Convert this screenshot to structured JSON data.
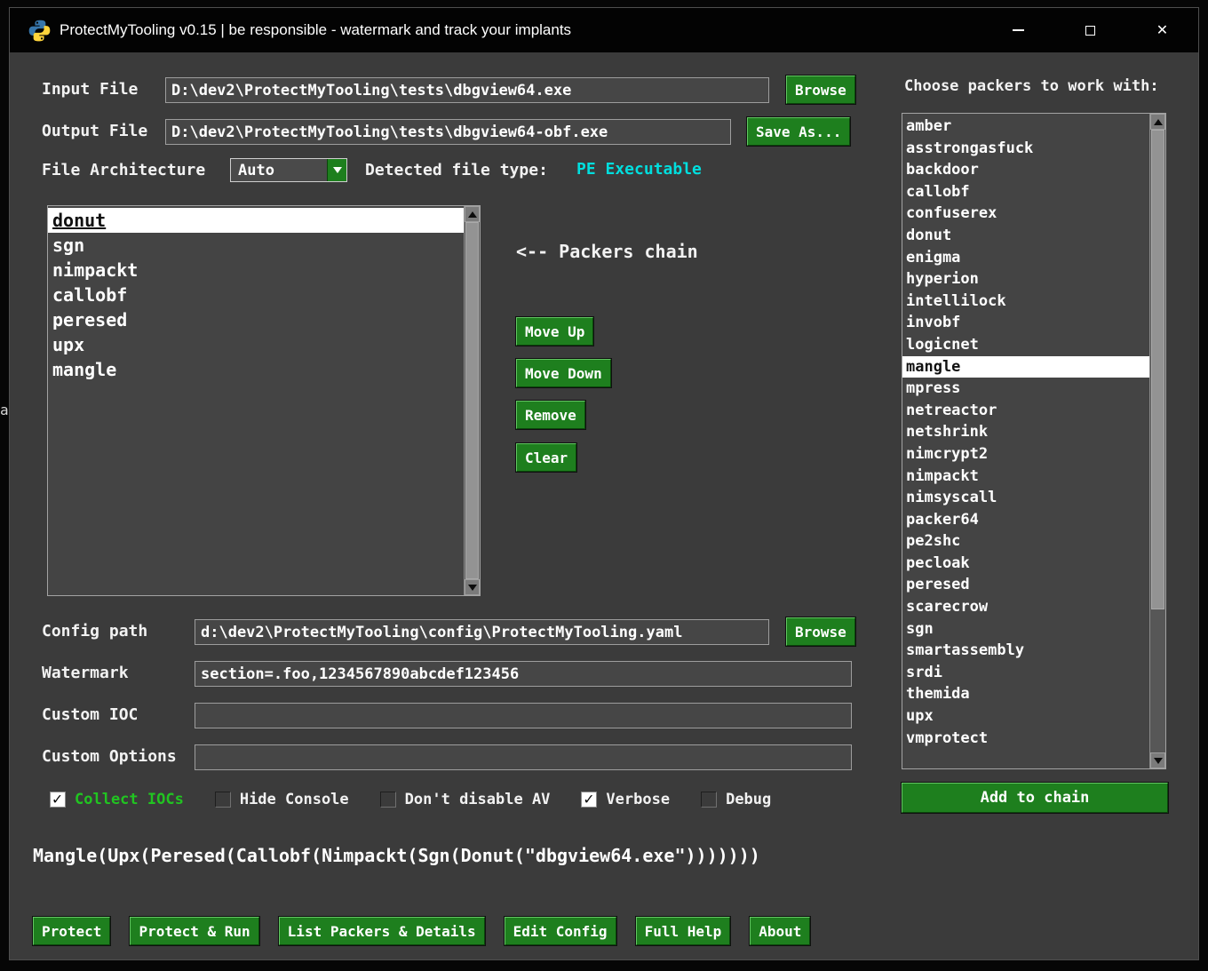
{
  "background": {
    "artifact": "a"
  },
  "window": {
    "title": "ProtectMyTooling v0.15 | be responsible - watermark and track your implants",
    "close_glyph": "✕"
  },
  "form": {
    "input_file_label": "Input File",
    "input_file_value": "D:\\dev2\\ProtectMyTooling\\tests\\dbgview64.exe",
    "input_browse_label": "Browse",
    "output_file_label": "Output File",
    "output_file_value": "D:\\dev2\\ProtectMyTooling\\tests\\dbgview64-obf.exe",
    "save_as_label": "Save As...",
    "file_architecture_label": "File Architecture",
    "file_architecture_value": "Auto",
    "detected_type_label": "Detected file type:",
    "detected_type_value": "PE Executable",
    "config_path_label": "Config path",
    "config_path_value": "d:\\dev2\\ProtectMyTooling\\config\\ProtectMyTooling.yaml",
    "config_browse_label": "Browse",
    "watermark_label": "Watermark",
    "watermark_value": "section=.foo,1234567890abcdef123456",
    "custom_ioc_label": "Custom IOC",
    "custom_ioc_value": "",
    "custom_options_label": "Custom Options",
    "custom_options_value": ""
  },
  "chain": {
    "hint": "<-- Packers chain",
    "items": [
      "donut",
      "sgn",
      "nimpackt",
      "callobf",
      "peresed",
      "upx",
      "mangle"
    ],
    "selected": "donut",
    "move_up_label": "Move Up",
    "move_down_label": "Move Down",
    "remove_label": "Remove",
    "clear_label": "Clear"
  },
  "packers": {
    "heading": "Choose packers to work with:",
    "items": [
      "amber",
      "asstrongasfuck",
      "backdoor",
      "callobf",
      "confuserex",
      "donut",
      "enigma",
      "hyperion",
      "intellilock",
      "invobf",
      "logicnet",
      "mangle",
      "mpress",
      "netreactor",
      "netshrink",
      "nimcrypt2",
      "nimpackt",
      "nimsyscall",
      "packer64",
      "pe2shc",
      "pecloak",
      "peresed",
      "scarecrow",
      "sgn",
      "smartassembly",
      "srdi",
      "themida",
      "upx",
      "vmprotect"
    ],
    "selected": "mangle",
    "add_button_label": "Add to chain"
  },
  "options": [
    {
      "label": "Collect IOCs",
      "checked": true,
      "accent": true
    },
    {
      "label": "Hide Console",
      "checked": false,
      "accent": false
    },
    {
      "label": "Don't disable AV",
      "checked": false,
      "accent": false
    },
    {
      "label": "Verbose",
      "checked": true,
      "accent": false
    },
    {
      "label": "Debug",
      "checked": false,
      "accent": false
    }
  ],
  "command_preview": "Mangle(Upx(Peresed(Callobf(Nimpackt(Sgn(Donut(\"dbgview64.exe\")))))))",
  "actions": {
    "protect": "Protect",
    "protect_run": "Protect & Run",
    "list_packers": "List Packers & Details",
    "edit_config": "Edit Config",
    "full_help": "Full Help",
    "about": "About"
  },
  "colors": {
    "accent_green": "#1e7f1e",
    "detected_type_color": "#00dede",
    "collect_iocs_color": "#21c421",
    "selection_background": "#ffffff",
    "window_background": "#3b3b3b"
  }
}
